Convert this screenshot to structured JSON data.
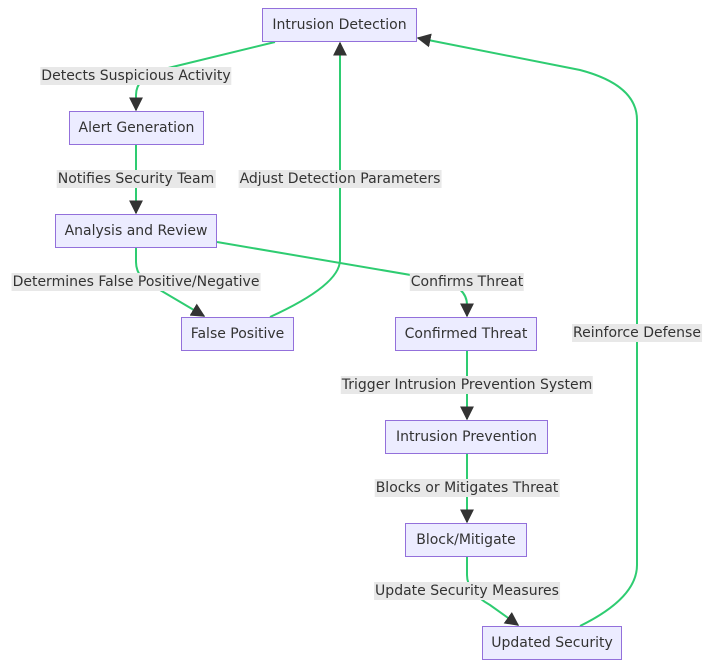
{
  "colors": {
    "node_fill": "#ECECFF",
    "node_stroke": "#9370DB",
    "edge": "#2ecc71",
    "label_bg": "#e8e8e8",
    "arrow": "#333333"
  },
  "nodes": {
    "intrusion_detection": "Intrusion Detection",
    "alert_generation": "Alert Generation",
    "analysis_review": "Analysis and Review",
    "false_positive": "False Positive",
    "confirmed_threat": "Confirmed Threat",
    "intrusion_prevention": "Intrusion Prevention",
    "block_mitigate": "Block/Mitigate",
    "updated_security": "Updated Security"
  },
  "edges": {
    "detects": "Detects Suspicious Activity",
    "notifies": "Notifies Security Team",
    "adjust": "Adjust Detection Parameters",
    "determines": "Determines False Positive/Negative",
    "confirms": "Confirms Threat",
    "trigger": "Trigger Intrusion Prevention System",
    "reinforce": "Reinforce Defense",
    "blocks": "Blocks or Mitigates Threat",
    "update": "Update Security Measures"
  }
}
